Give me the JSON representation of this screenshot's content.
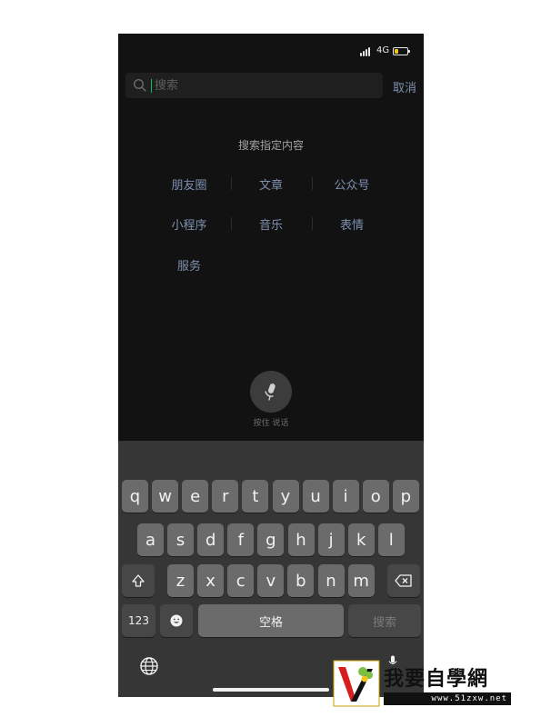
{
  "status_bar": {
    "network": "4G",
    "battery_level": 0.3,
    "battery_color": "#f3c316"
  },
  "search": {
    "placeholder": "搜索",
    "cancel_label": "取消",
    "icon": "search-icon",
    "caret_color": "#07c160"
  },
  "specific_search": {
    "title": "搜索指定内容",
    "categories": [
      "朋友圈",
      "文章",
      "公众号",
      "小程序",
      "音乐",
      "表情",
      "服务"
    ]
  },
  "voice": {
    "icon": "microphone-icon",
    "label": "按住 说话"
  },
  "keyboard": {
    "row1": [
      "q",
      "w",
      "e",
      "r",
      "t",
      "y",
      "u",
      "i",
      "o",
      "p"
    ],
    "row2": [
      "a",
      "s",
      "d",
      "f",
      "g",
      "h",
      "j",
      "k",
      "l"
    ],
    "row3": [
      "z",
      "x",
      "c",
      "v",
      "b",
      "n",
      "m"
    ],
    "shift_icon": "shift-icon",
    "delete_icon": "backspace-icon",
    "numbers_label": "123",
    "emoji_icon": "emoji-icon",
    "space_label": "空格",
    "search_label": "搜索",
    "globe_icon": "globe-icon",
    "dictation_icon": "microphone-icon"
  },
  "watermark": {
    "brand": "我要自學網",
    "site": "www.51zxw.net"
  },
  "colors": {
    "background": "#121212",
    "link": "#7e90b0",
    "keyboard": "#363636",
    "key": "#6b6b6b"
  }
}
